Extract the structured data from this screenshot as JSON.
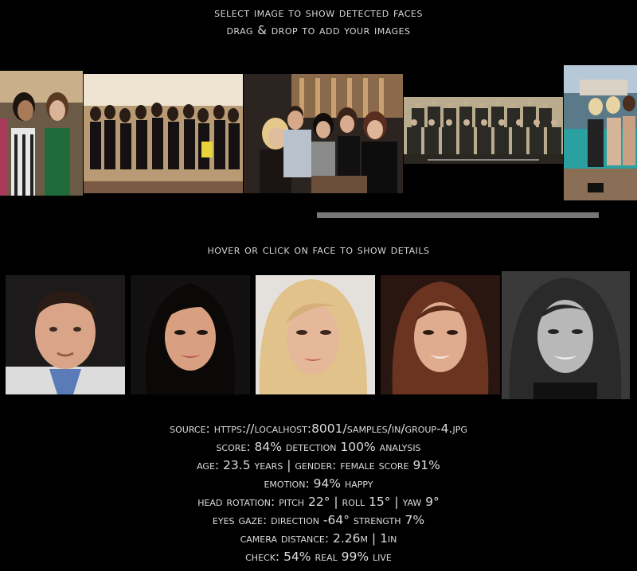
{
  "header": {
    "line1": "select image to show detected faces",
    "line2": "drag & drop to add your images"
  },
  "gallery": {
    "images": [
      {
        "icon": "group-photo-1",
        "selected": false
      },
      {
        "icon": "group-photo-2",
        "selected": false
      },
      {
        "icon": "group-photo-3",
        "selected": true
      },
      {
        "icon": "group-photo-4",
        "selected": false
      },
      {
        "icon": "group-photo-5",
        "selected": false
      }
    ]
  },
  "faces_caption": "hover or click on face to show details",
  "faces": [
    {
      "icon": "face-man"
    },
    {
      "icon": "face-woman-dark-hair"
    },
    {
      "icon": "face-woman-blonde"
    },
    {
      "icon": "face-woman-brunette"
    },
    {
      "icon": "face-woman-grayscale"
    }
  ],
  "details": {
    "source": "source: https://localhost:8001/samples/in/group-4.jpg",
    "score": "score: 84% detection 100% analysis",
    "age_gender": "age: 23.5 years | gender: female score 91%",
    "emotion": "emotion: 94% happy",
    "head_rotation": "head rotation: pitch 22° | roll 15° | yaw 9°",
    "eyes_gaze": "eyes gaze: direction -64° strength 7%",
    "camera_distance": "camera distance: 2.26m | 1in",
    "check": "check: 54% real 99% live"
  }
}
